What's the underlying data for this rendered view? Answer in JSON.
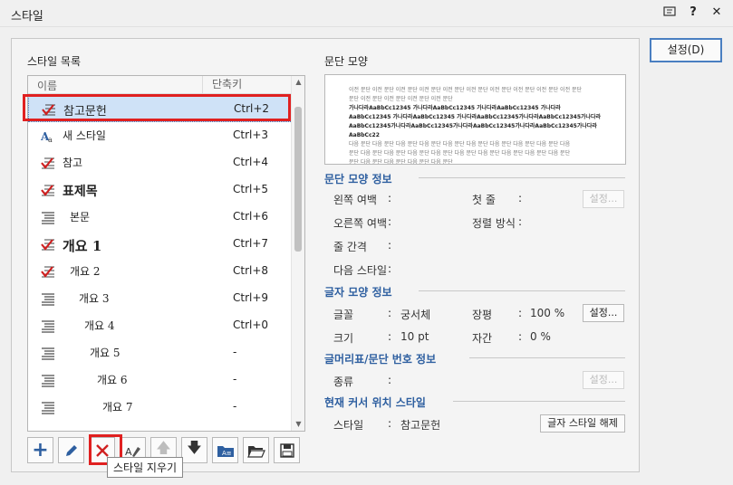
{
  "window": {
    "title": "스타일",
    "icons": [
      "dialog-icon",
      "help-icon",
      "close-icon"
    ]
  },
  "setting_button": "설정(D)",
  "list": {
    "label": "스타일 목록",
    "col_name": "이름",
    "col_key": "단축키",
    "items": [
      {
        "icon": "para-check",
        "name": "참고문헌",
        "key": "Ctrl+2"
      },
      {
        "icon": "char-style",
        "name": "새 스타일",
        "key": "Ctrl+3"
      },
      {
        "icon": "para-check",
        "name": "참고",
        "key": "Ctrl+4"
      },
      {
        "icon": "para-check",
        "name": "표제목",
        "key": "Ctrl+5"
      },
      {
        "icon": "para",
        "name": "본문",
        "key": "Ctrl+6"
      },
      {
        "icon": "para-check",
        "name": "개요 1",
        "key": "Ctrl+7"
      },
      {
        "icon": "para-check",
        "name": "개요 2",
        "key": "Ctrl+8"
      },
      {
        "icon": "para",
        "name": "개요 3",
        "key": "Ctrl+9"
      },
      {
        "icon": "para",
        "name": "개요 4",
        "key": "Ctrl+0"
      },
      {
        "icon": "para",
        "name": "개요 5",
        "key": "-"
      },
      {
        "icon": "para",
        "name": "개요 6",
        "key": "-"
      },
      {
        "icon": "para",
        "name": "개요 7",
        "key": "-"
      }
    ]
  },
  "toolbar": {
    "buttons": [
      "add",
      "edit",
      "delete",
      "replace",
      "move-up",
      "move-down",
      "import",
      "open",
      "save"
    ],
    "tooltip": "스타일 지우기"
  },
  "preview": {
    "label": "문단 모양",
    "lines": [
      "이전 문단 이전 문단 이전 문단 이전 문단 이전 문단 이전 문단 이전 문단 이전 문단 이전 문단 이전 문단",
      "문단 이전 문단 이전 문단 이전 문단 이전 문단",
      "가나다라AaBbCc12345    가나다라AaBbCc12345    가나다라AaBbCc12345    가나다라",
      "AaBbCc12345 가나다라AaBbCc12345  가나다라AaBbCc12345가나다라AaBbCc12345가나다라",
      "AaBbCc12345가나다라AaBbCc12345가나다라AaBbCc12345가나다라AaBbCc12345가나다라",
      "AaBbCc22",
      "다음 문단 다음 문단 다음 문단 다음 문단 다음 문단 다음 문단 다음 문단 다음 문단 다음 문단 다음",
      "문단 다음 문단 다음 문단 다음 문단 다음 문단 다음 문단 다음 문단 다음 문단 다음 문단 다음 문단",
      "문단 다음 문단 다음 문단 다음 문단 다음 문단"
    ]
  },
  "para_info": {
    "title": "문단 모양 정보",
    "left_margin": "왼쪽 여백",
    "first_line": "첫 줄",
    "right_margin": "오른쪽 여백",
    "align": "정렬 방식",
    "line_spacing": "줄 간격",
    "next_style": "다음 스타일",
    "button": "설정..."
  },
  "char_info": {
    "title": "글자 모양 정보",
    "font_label": "글꼴",
    "font_value": "궁서체",
    "width_label": "장평",
    "width_value": "100 %",
    "size_label": "크기",
    "size_value": "10 pt",
    "spacing_label": "자간",
    "spacing_value": "0 %",
    "button": "설정..."
  },
  "bullet_info": {
    "title": "글머리표/문단 번호 정보",
    "kind_label": "종류",
    "button": "설정..."
  },
  "cursor_info": {
    "title": "현재 커서 위치 스타일",
    "style_label": "스타일",
    "style_value": "참고문헌",
    "button": "글자 스타일 해제"
  }
}
